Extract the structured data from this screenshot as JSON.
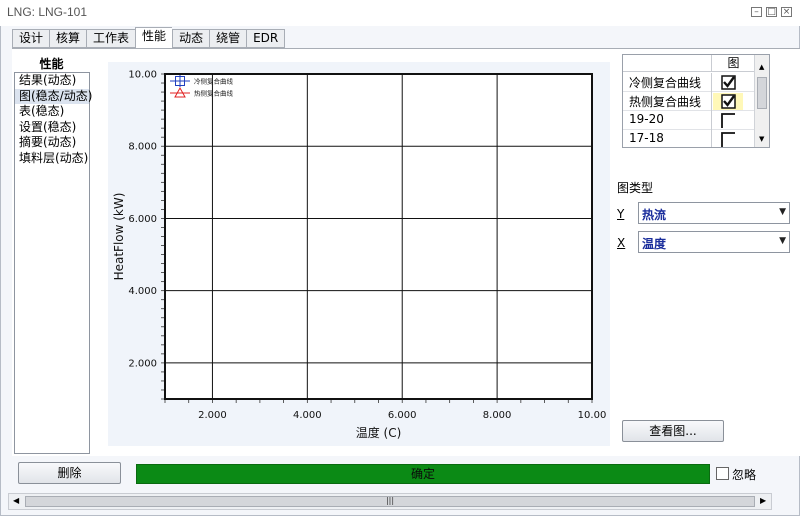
{
  "window": {
    "title": "LNG: LNG-101"
  },
  "tabs": [
    {
      "label": "设计"
    },
    {
      "label": "核算"
    },
    {
      "label": "工作表"
    },
    {
      "label": "性能"
    },
    {
      "label": "动态"
    },
    {
      "label": "绕管"
    },
    {
      "label": "EDR"
    }
  ],
  "nav": {
    "header": "性能",
    "items": [
      {
        "label": "结果(动态)"
      },
      {
        "label": "图(稳态/动态)"
      },
      {
        "label": "表(稳态)"
      },
      {
        "label": "设置(稳态)"
      },
      {
        "label": "摘要(动态)"
      },
      {
        "label": "填料层(动态)"
      }
    ]
  },
  "curve_table": {
    "header": "图",
    "rows": [
      {
        "name": "冷侧复合曲线",
        "checked": true
      },
      {
        "name": "热侧复合曲线",
        "checked": true
      },
      {
        "name": "19-20",
        "checked": false
      },
      {
        "name": "17-18",
        "checked": false
      }
    ]
  },
  "plot_type": {
    "label": "图类型",
    "y_label": "Y",
    "y_value": "热流",
    "x_label": "X",
    "x_value": "温度"
  },
  "buttons": {
    "view_plot": "查看图...",
    "delete": "删除",
    "ok": "确定",
    "ignore": "忽略"
  },
  "chart_data": {
    "type": "line",
    "xlabel": "温度 (C)",
    "ylabel": "HeatFlow (kW)",
    "xlim": [
      1.0,
      10.0
    ],
    "ylim": [
      1.0,
      10.0
    ],
    "x_ticks": [
      "2.000",
      "4.000",
      "6.000",
      "8.000",
      "10.00"
    ],
    "y_ticks": [
      "2.000",
      "4.000",
      "6.000",
      "8.000",
      "10.00"
    ],
    "legend_position": "top-left",
    "grid": true,
    "series": [
      {
        "name": "冷侧复合曲线",
        "color": "#1f3fbf",
        "marker": "square",
        "x": [],
        "y": []
      },
      {
        "name": "热侧复合曲线",
        "color": "#e02020",
        "marker": "triangle",
        "x": [],
        "y": []
      }
    ]
  }
}
